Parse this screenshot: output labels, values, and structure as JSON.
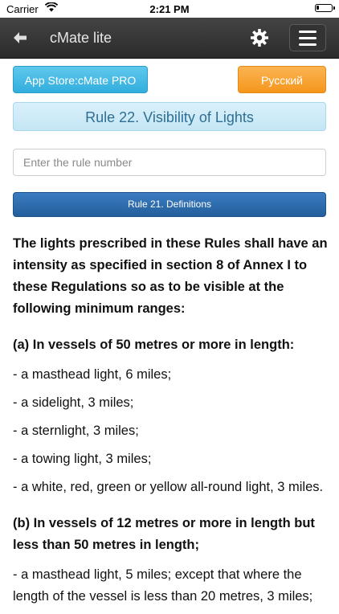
{
  "status_bar": {
    "carrier": "Carrier",
    "time": "2:21 PM"
  },
  "navbar": {
    "title": "cMate lite",
    "back_icon": "arrow-left-icon",
    "settings_icon": "gear-icon",
    "menu_icon": "hamburger-menu-icon"
  },
  "buttons": {
    "app_store_pro": "App Store:cMate PRO",
    "language": "Русский",
    "previous_rule": "Rule 21. Definitions"
  },
  "rule": {
    "title": "Rule 22. Visibility of Lights",
    "input_placeholder": "Enter the rule number",
    "input_value": ""
  },
  "content": {
    "intro": "The lights prescribed in these Rules shall have an intensity as specified in section 8 of Annex I to these Regulations so as to be visible at the following minimum ranges:",
    "section_a": {
      "heading": "(a) In vessels of 50 metres or more in length:",
      "items": [
        "- a masthead light, 6 miles;",
        "- a sidelight, 3 miles;",
        "- a sternlight, 3 miles;",
        "- a towing light, 3 miles;",
        "- a white, red, green or yellow all-round light, 3 miles."
      ]
    },
    "section_b": {
      "heading": "(b) In vessels of 12 metres or more in length but less than 50 metres in length;",
      "items": [
        "- a masthead light, 5 miles; except that where the length of the vessel is less than 20 metres, 3 miles;"
      ]
    }
  },
  "colors": {
    "navbar": "#333333",
    "pro_button": "#3bb3e0",
    "language_button": "#f7a030",
    "rule_title_bg": "#cde9f6",
    "rule_title_text": "#2e6f93",
    "prev_button": "#2d6aac"
  }
}
